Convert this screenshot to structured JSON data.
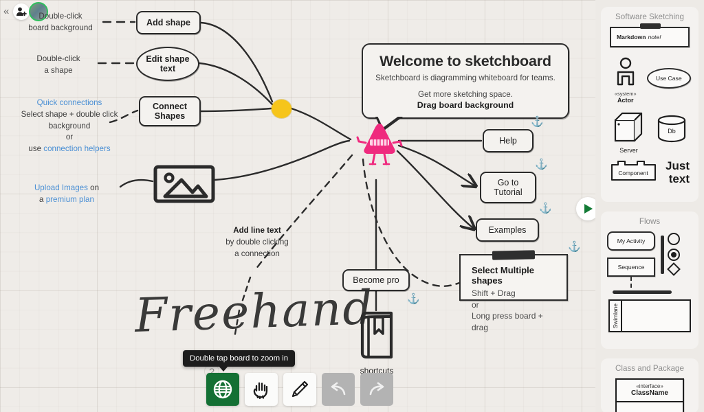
{
  "app": {
    "title": "Sketchboard"
  },
  "topbar": {
    "collapse_icon": "chevron-double-left-icon",
    "add_user_icon": "add-user-icon",
    "avatar_label": "user-avatar"
  },
  "canvas": {
    "hub_node_label": "",
    "mascot_label": "sketchboard-mascot",
    "freehand_word": "Freehand",
    "annotations": [
      {
        "id": "double-click-board",
        "lines": [
          {
            "text": "Double-click",
            "style": "plain"
          },
          {
            "text": "board background",
            "style": "plain"
          }
        ]
      },
      {
        "id": "double-click-shape",
        "lines": [
          {
            "text": "Double-click",
            "style": "plain"
          },
          {
            "text": "a shape",
            "style": "plain"
          }
        ]
      },
      {
        "id": "quick-connections",
        "lines": [
          {
            "text": "Quick connections",
            "style": "link"
          },
          {
            "text": "Select shape + double click",
            "style": "plain"
          },
          {
            "text": "background",
            "style": "plain"
          },
          {
            "text": "or",
            "style": "plain"
          },
          {
            "text": "use connection helpers",
            "style": "mixed",
            "prefix": "use ",
            "link": "connection helpers"
          }
        ]
      },
      {
        "id": "upload-images",
        "lines": [
          {
            "text": "Upload Images on",
            "style": "mixed",
            "link": "Upload Images",
            "suffix": " on"
          },
          {
            "text": "a premium plan",
            "style": "mixed",
            "prefix": "a ",
            "link": "premium plan"
          }
        ]
      },
      {
        "id": "add-line-text",
        "lines": [
          {
            "text": "Add line text",
            "style": "bold"
          },
          {
            "text": "by double clicking",
            "style": "plain"
          },
          {
            "text": "a connection",
            "style": "plain"
          }
        ]
      }
    ],
    "nodes": [
      {
        "id": "add-shape",
        "label": "Add shape",
        "shape": "rounded"
      },
      {
        "id": "edit-shape-text",
        "label": "Edit shape\ntext",
        "shape": "ellipse"
      },
      {
        "id": "connect-shapes",
        "label": "Connect\nShapes",
        "shape": "rounded"
      },
      {
        "id": "help",
        "label": "Help",
        "shape": "rounded"
      },
      {
        "id": "go-to-tutorial",
        "label": "Go to\nTutorial",
        "shape": "rounded"
      },
      {
        "id": "examples",
        "label": "Examples",
        "shape": "rounded"
      },
      {
        "id": "become-pro",
        "label": "Become pro",
        "shape": "rounded"
      }
    ],
    "welcome": {
      "title": "Welcome to sketchboard",
      "subtitle": "Sketchboard is diagramming whiteboard for teams.",
      "hint": "Get more sketching space.",
      "hint_bold": "Drag board background"
    },
    "select_note": {
      "heading": "Select Multiple shapes",
      "lines": [
        "Shift + Drag",
        "or",
        "Long press board + drag"
      ]
    },
    "shortcuts_label": "shortcuts",
    "anchor_icon": "anchor-icon",
    "anchor_count": 5
  },
  "tooltip": {
    "text": "Double tap board to zoom in",
    "help_icon": "question-mark-icon"
  },
  "toolbar": {
    "items": [
      {
        "id": "pan-zoom",
        "icon": "globe-icon",
        "state": "active"
      },
      {
        "id": "hand-tool",
        "icon": "hand-icon",
        "state": "normal"
      },
      {
        "id": "pencil-tool",
        "icon": "pencil-icon",
        "state": "normal"
      },
      {
        "id": "undo",
        "icon": "undo-arrow-icon",
        "state": "disabled"
      },
      {
        "id": "redo",
        "icon": "redo-arrow-icon",
        "state": "disabled"
      }
    ]
  },
  "expand_handle": {
    "icon": "play-triangle-icon"
  },
  "panel": {
    "groups": [
      {
        "title": "Software Sketching",
        "items": [
          {
            "id": "markdown-note",
            "label": "Markdown note!",
            "label_bold": "Markdown",
            "label_italic": "note!",
            "kind": "note"
          },
          {
            "id": "actor",
            "label": "Actor",
            "stereotype": "«system»",
            "kind": "actor"
          },
          {
            "id": "use-case",
            "label": "Use Case",
            "kind": "ellipse"
          },
          {
            "id": "server",
            "label": "Server",
            "kind": "cube"
          },
          {
            "id": "db",
            "label": "Db",
            "kind": "cylinder"
          },
          {
            "id": "component",
            "label": "Component",
            "kind": "component"
          },
          {
            "id": "just-text",
            "label": "Just\ntext",
            "kind": "text"
          }
        ]
      },
      {
        "title": "Flows",
        "items": [
          {
            "id": "my-activity",
            "label": "My Activity",
            "kind": "rounded"
          },
          {
            "id": "sequence",
            "label": "Sequence",
            "kind": "rect"
          },
          {
            "id": "bar-vertical",
            "label": "",
            "kind": "vbar"
          },
          {
            "id": "circle",
            "label": "",
            "kind": "circle"
          },
          {
            "id": "circle-dot",
            "label": "",
            "kind": "circle-dot"
          },
          {
            "id": "diamond",
            "label": "",
            "kind": "diamond"
          },
          {
            "id": "bar-horizontal",
            "label": "",
            "kind": "hbar"
          },
          {
            "id": "swimlane",
            "label": "Swimlane",
            "kind": "swimlane"
          }
        ]
      },
      {
        "title": "Class and Package",
        "items": [
          {
            "id": "class",
            "label": "ClassName",
            "stereotype": "«interface»",
            "kind": "class"
          }
        ]
      }
    ]
  },
  "colors": {
    "accent_green": "#147034",
    "anchor_green": "#1e7c41",
    "link_blue": "#4a8fd4",
    "mascot_pink": "#ef2a7e",
    "hub_yellow": "#f6c51b",
    "ink": "#2b2b2b",
    "canvas_bg": "#efece8",
    "panel_bg": "#edeae6"
  }
}
